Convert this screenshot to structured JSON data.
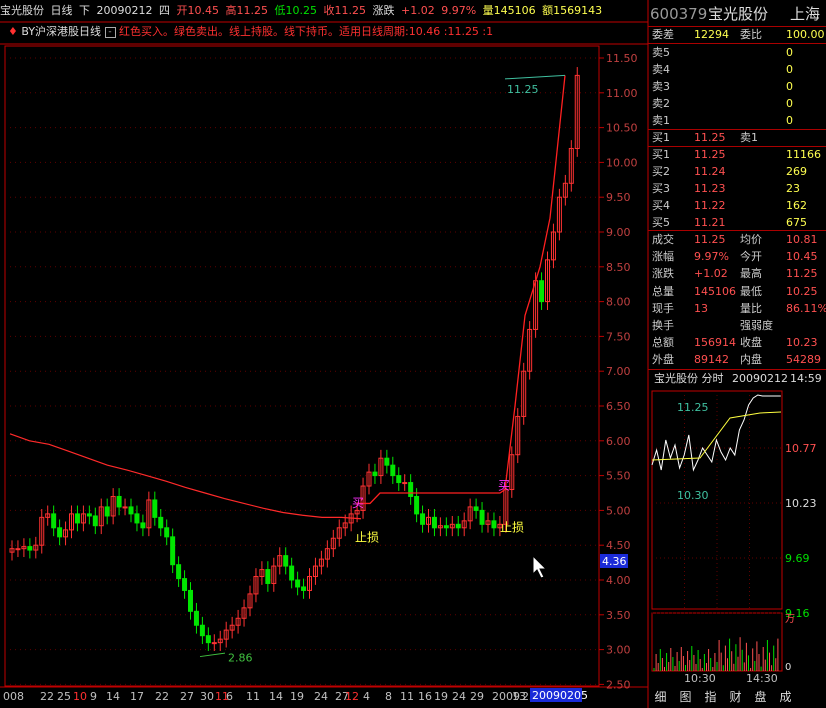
{
  "header": {
    "name": "宝光股份",
    "period": "日线",
    "mode": "下",
    "date": "20090212",
    "weekday": "四",
    "open": "开10.45",
    "high": "高11.25",
    "low": "低10.25",
    "close": "收11.25",
    "chg_label": "涨跌",
    "chg": "+1.02",
    "pct": "9.97%",
    "volume": "量145106",
    "amount": "额1569143"
  },
  "indicator": {
    "name": "BY沪深港股日线",
    "text": "红色买入。绿色卖出。线上持股。线下持币。适用日线周期:10.46 :11.25 :1"
  },
  "price_axis": [
    "11.50",
    "11.00",
    "10.50",
    "10.00",
    "9.50",
    "9.00",
    "8.50",
    "8.00",
    "7.50",
    "7.00",
    "6.50",
    "6.00",
    "5.50",
    "5.00",
    "4.50",
    "4.00",
    "3.50",
    "3.00",
    "2.50"
  ],
  "current_price_tag": "4.36",
  "annotations": {
    "high_label": "11.25",
    "low_label": "2.86",
    "buy1": "买",
    "buy2": "买",
    "stop1": "止损",
    "stop2": "止损"
  },
  "date_axis": [
    "008",
    "22",
    "25",
    "10",
    "9",
    "14",
    "17",
    "22",
    "27",
    "30",
    "11",
    "6",
    "11",
    "14",
    "19",
    "24",
    "27",
    "12",
    "4",
    "8",
    "11",
    "16",
    "19",
    "24",
    "29",
    "2009",
    "13",
    "23",
    "4"
  ],
  "date_axis_highlight": "20090205",
  "quote": {
    "code": "600379",
    "name": "宝光股份",
    "market": "上海",
    "weicha_label": "委差",
    "weicha": "12294",
    "weibi_label": "委比",
    "weibi": "100.00",
    "sells": [
      {
        "label": "卖5",
        "price": "",
        "vol": "0"
      },
      {
        "label": "卖4",
        "price": "",
        "vol": "0"
      },
      {
        "label": "卖3",
        "price": "",
        "vol": "0"
      },
      {
        "label": "卖2",
        "price": "",
        "vol": "0"
      },
      {
        "label": "卖1",
        "price": "",
        "vol": "0"
      }
    ],
    "buy_hint": {
      "label": "买1",
      "price": "11.25",
      "extra": "卖1"
    },
    "buys": [
      {
        "label": "买1",
        "price": "11.25",
        "vol": "11166"
      },
      {
        "label": "买2",
        "price": "11.24",
        "vol": "269"
      },
      {
        "label": "买3",
        "price": "11.23",
        "vol": "23"
      },
      {
        "label": "买4",
        "price": "11.22",
        "vol": "162"
      },
      {
        "label": "买5",
        "price": "11.21",
        "vol": "675"
      }
    ],
    "stats": [
      {
        "l1": "成交",
        "v1": "11.25",
        "l2": "均价",
        "v2": "10.81"
      },
      {
        "l1": "涨幅",
        "v1": "9.97%",
        "l2": "今开",
        "v2": "10.45"
      },
      {
        "l1": "涨跌",
        "v1": "+1.02",
        "l2": "最高",
        "v2": "11.25"
      },
      {
        "l1": "总量",
        "v1": "145106",
        "l2": "最低",
        "v2": "10.25"
      },
      {
        "l1": "现手",
        "v1": "13",
        "l2": "量比",
        "v2": "86.11%"
      },
      {
        "l1": "换手",
        "v1": "",
        "l2": "强弱度",
        "v2": ""
      },
      {
        "l1": "总额",
        "v1": "156914",
        "l2": "收盘",
        "v2": "10.23"
      },
      {
        "l1": "外盘",
        "v1": "89142",
        "l2": "内盘",
        "v2": "54289"
      }
    ]
  },
  "minichart": {
    "title": "宝光股份 分时",
    "date": "20090212",
    "time": "14:59",
    "high_tag": "11.25",
    "low_tag": "10.30",
    "axis": [
      "10.77",
      "10.23",
      "9.69",
      "9.16"
    ],
    "vol_axis_label": "万",
    "vol_zero": "0",
    "time_labels": [
      "10:30",
      "14:30"
    ]
  },
  "tabs": [
    "细",
    "图",
    "指",
    "财",
    "盘",
    "成"
  ],
  "colors": {
    "up": "#ff3232",
    "down": "#00e600",
    "axis": "#c00000",
    "bg": "#000000"
  }
}
